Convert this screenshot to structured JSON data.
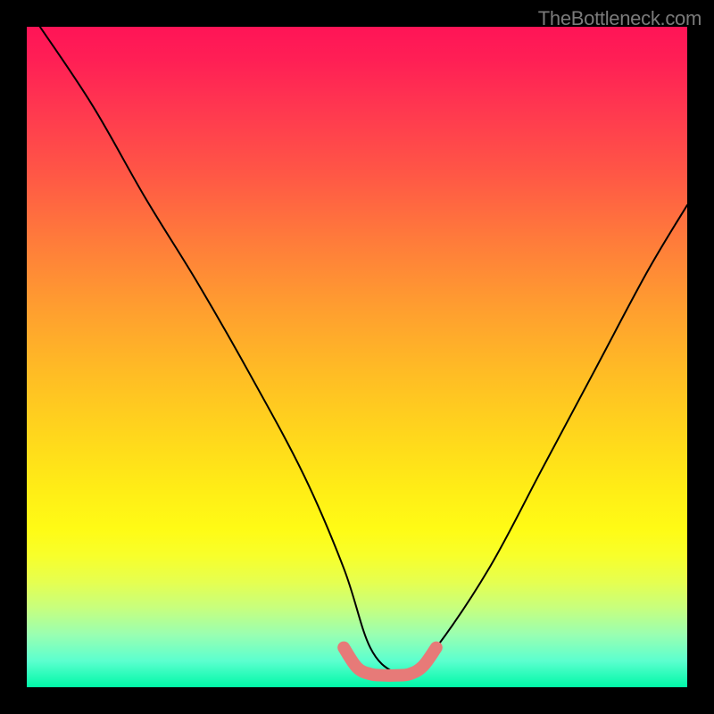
{
  "watermark": "TheBottleneck.com",
  "chart_data": {
    "type": "line",
    "title": "",
    "xlabel": "",
    "ylabel": "",
    "xlim": [
      0,
      100
    ],
    "ylim": [
      0,
      100
    ],
    "background_gradient": {
      "top": "#ff1456",
      "bottom": "#00f8a8",
      "stops": [
        "red",
        "orange",
        "yellow",
        "green"
      ]
    },
    "series": [
      {
        "name": "bottleneck-curve",
        "type": "line",
        "color": "#000000",
        "x": [
          2,
          10,
          18,
          26,
          34,
          42,
          48,
          52,
          56,
          58,
          62,
          70,
          78,
          86,
          94,
          100
        ],
        "values": [
          100,
          88,
          74,
          61,
          47,
          32,
          18,
          6,
          2,
          2,
          6,
          18,
          33,
          48,
          63,
          73
        ]
      },
      {
        "name": "optimal-range-marker",
        "type": "line",
        "color": "#e77a78",
        "x": [
          48,
          50,
          52,
          54,
          56,
          58,
          60,
          62
        ],
        "values": [
          6,
          3,
          2,
          1.8,
          1.8,
          2,
          3.2,
          6
        ]
      }
    ],
    "annotations": []
  }
}
